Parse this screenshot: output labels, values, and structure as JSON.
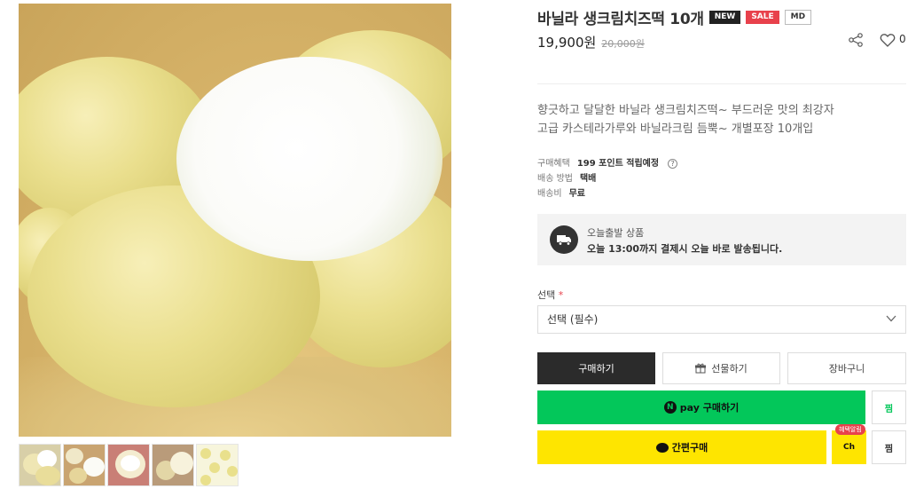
{
  "product": {
    "title": "바닐라 생크림치즈떡 10개",
    "badges": {
      "new": "NEW",
      "sale": "SALE",
      "md": "MD"
    },
    "price": "19,900원",
    "original_price": "20,000원",
    "like_count": "0"
  },
  "description": {
    "line1": "향긋하고 달달한 바닐라 생크림치즈떡~ 부드러운 맛의 최강자",
    "line2": "고급 카스테라가루와 바닐라크림 듬뿍~ 개별포장 10개입"
  },
  "meta": {
    "benefit_label": "구매혜택",
    "benefit_value": "199 포인트 적립예정",
    "help_glyph": "?",
    "shipping_method_label": "배송 방법",
    "shipping_method_value": "택배",
    "shipping_fee_label": "배송비",
    "shipping_fee_value": "무료"
  },
  "today_shipping": {
    "title": "오늘출발 상품",
    "text": "오늘 13:00까지 결제시 오늘 바로 발송됩니다."
  },
  "option": {
    "label": "선택",
    "required_mark": "*",
    "selected": "선택 (필수)"
  },
  "buttons": {
    "buy": "구매하기",
    "gift": "선물하기",
    "cart": "장바구니",
    "npay_n": "N",
    "npay_label": "pay 구매하기",
    "npay_zzim": "찜",
    "kakao_label": "간편구매",
    "kakao_ch": "Ch",
    "kakao_ch_tag": "혜택알림",
    "kakao_zzim": "찜"
  },
  "icons": {
    "share": "share-icon",
    "heart": "heart-icon",
    "truck": "truck-icon",
    "chevron": "chevron-down-icon",
    "gift": "gift-icon"
  },
  "colors": {
    "npay_green": "#03c75a",
    "kakao_yellow": "#fee500",
    "sale_red": "#e8414c",
    "dark": "#2b2b2b"
  }
}
